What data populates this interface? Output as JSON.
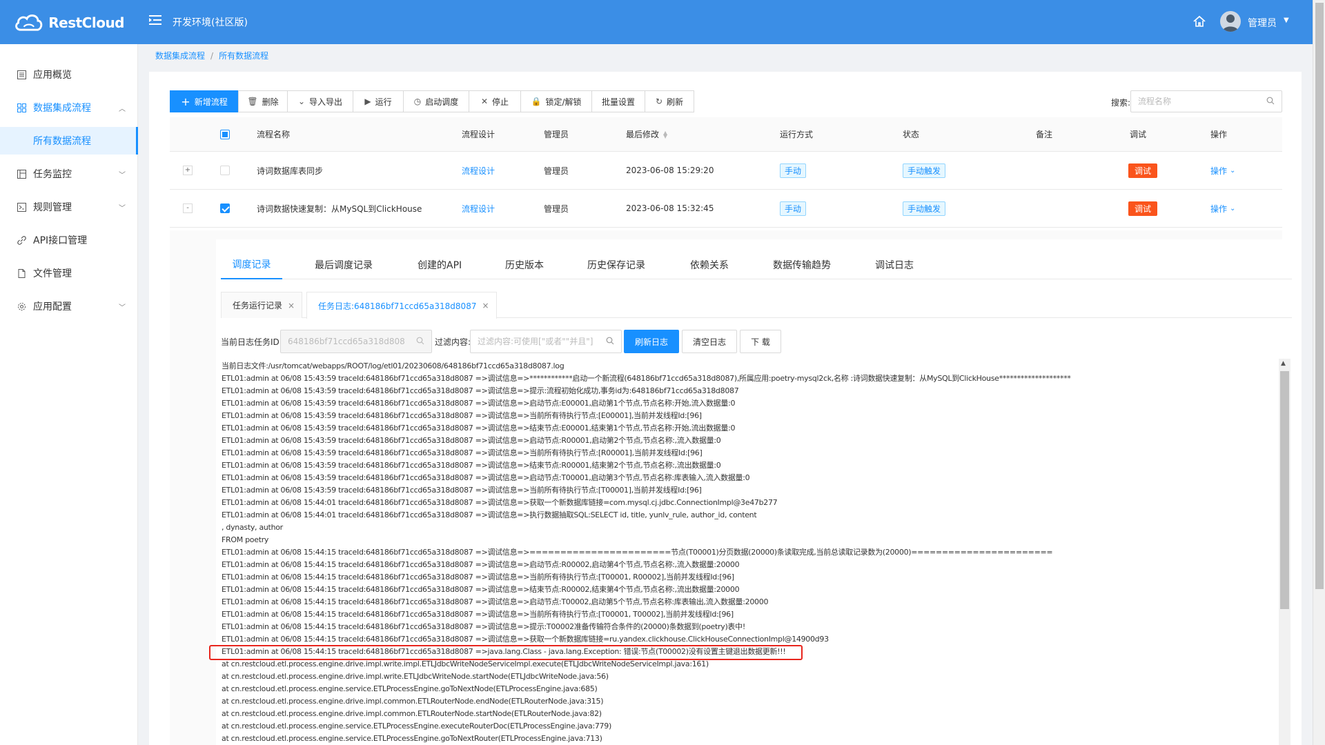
{
  "app": {
    "logo_text": "RestCloud",
    "env_title": "开发环境(社区版)",
    "user_name": "管理员"
  },
  "sidebar": {
    "items": [
      {
        "label": "应用概览",
        "icon": "dashboard-icon"
      },
      {
        "label": "数据集成流程",
        "icon": "grid-icon",
        "open": true
      },
      {
        "label": "所有数据流程",
        "sub": true
      },
      {
        "label": "任务监控",
        "icon": "monitor-icon"
      },
      {
        "label": "规则管理",
        "icon": "code-icon"
      },
      {
        "label": "API接口管理",
        "icon": "link-icon"
      },
      {
        "label": "文件管理",
        "icon": "file-icon"
      },
      {
        "label": "应用配置",
        "icon": "gear-icon"
      }
    ]
  },
  "breadcrumb": [
    "数据集成流程",
    "所有数据流程"
  ],
  "toolbar": {
    "new": "新增流程",
    "delete": "删除",
    "import_export": "导入导出",
    "run": "运行",
    "schedule": "启动调度",
    "stop": "停止",
    "lock": "锁定/解锁",
    "batch": "批量设置",
    "refresh": "刷新"
  },
  "search": {
    "label": "搜索:",
    "placeholder": "流程名称"
  },
  "table": {
    "headers": {
      "name": "流程名称",
      "design": "流程设计",
      "owner": "管理员",
      "modified": "最后修改",
      "run_mode": "运行方式",
      "status": "状态",
      "note": "备注",
      "debug": "调试",
      "action": "操作"
    },
    "rows": [
      {
        "expand": "+",
        "name": "诗词数据库表同步",
        "design": "流程设计",
        "owner": "管理员",
        "modified": "2023-06-08 15:29:20",
        "run_mode": "手动",
        "status": "手动触发",
        "debug": "调试",
        "action": "操作"
      },
      {
        "expand": "-",
        "name": "诗词数据快速复制：从MySQL到ClickHouse",
        "design": "流程设计",
        "owner": "管理员",
        "modified": "2023-06-08 15:32:45",
        "run_mode": "手动",
        "status": "手动触发",
        "debug": "调试",
        "action": "操作"
      }
    ]
  },
  "detail_tabs": [
    "调度记录",
    "最后调度记录",
    "创建的API",
    "历史版本",
    "历史保存记录",
    "依赖关系",
    "数据传输趋势",
    "调试日志"
  ],
  "content_tabs": [
    "任务运行记录",
    "任务日志:648186bf71ccd65a318d8087"
  ],
  "logbar": {
    "task_id_label": "当前日志任务ID:",
    "task_id_value": "648186bf71ccd65a318d8087",
    "filter_label": "过滤内容:",
    "filter_placeholder": "过滤内容:可使用[\"或者\"\"并且\"]",
    "refresh_btn": "刷新日志",
    "clear_btn": "清空日志",
    "download_btn": "下 载"
  },
  "log_lines": [
    "当前日志文件:/usr/tomcat/webapps/ROOT/log/etl01/20230608/648186bf71ccd65a318d8087.log",
    "ETL01:admin at 06/08 15:43:59 traceId:648186bf71ccd65a318d8087 =>调试信息=>************启动一个新流程(648186bf71ccd65a318d8087),所属应用:poetry-mysql2ck,名称 :诗词数据快速复制：从MySQL到ClickHouse********************",
    "ETL01:admin at 06/08 15:43:59 traceId:648186bf71ccd65a318d8087 =>调试信息=>提示:流程初始化成功,事务id为:648186bf71ccd65a318d8087",
    "ETL01:admin at 06/08 15:43:59 traceId:648186bf71ccd65a318d8087 =>调试信息=>启动节点:E00001,启动第1个节点,节点名称:开始,流入数据量:0",
    "ETL01:admin at 06/08 15:43:59 traceId:648186bf71ccd65a318d8087 =>调试信息=>当前所有待执行节点:[E00001],当前并发线程Id:[96]",
    "ETL01:admin at 06/08 15:43:59 traceId:648186bf71ccd65a318d8087 =>调试信息=>结束节点:E00001,结束第1个节点,节点名称:开始,流出数据量:0",
    "ETL01:admin at 06/08 15:43:59 traceId:648186bf71ccd65a318d8087 =>调试信息=>启动节点:R00001,启动第2个节点,节点名称:,流入数据量:0",
    "ETL01:admin at 06/08 15:43:59 traceId:648186bf71ccd65a318d8087 =>调试信息=>当前所有待执行节点:[R00001],当前并发线程Id:[96]",
    "ETL01:admin at 06/08 15:43:59 traceId:648186bf71ccd65a318d8087 =>调试信息=>结束节点:R00001,结束第2个节点,节点名称:,流出数据量:0",
    "ETL01:admin at 06/08 15:43:59 traceId:648186bf71ccd65a318d8087 =>调试信息=>启动节点:T00001,启动第3个节点,节点名称:库表输入,流入数据量:0",
    "ETL01:admin at 06/08 15:43:59 traceId:648186bf71ccd65a318d8087 =>调试信息=>当前所有待执行节点:[T00001],当前并发线程Id:[96]",
    "ETL01:admin at 06/08 15:44:01 traceId:648186bf71ccd65a318d8087 =>调试信息=>获取一个新数据库链接=com.mysql.cj.jdbc.ConnectionImpl@3e47b277",
    "ETL01:admin at 06/08 15:44:01 traceId:648186bf71ccd65a318d8087 =>调试信息=>执行数据抽取SQL:SELECT id, title, yunlv_rule, author_id, content",
    ", dynasty, author",
    "FROM poetry",
    "ETL01:admin at 06/08 15:44:15 traceId:648186bf71ccd65a318d8087 =>调试信息=>=======================节点(T00001)分页数据(20000)条读取完成,当前总读取记录数为(20000)=======================",
    "ETL01:admin at 06/08 15:44:15 traceId:648186bf71ccd65a318d8087 =>调试信息=>启动节点:R00002,启动第4个节点,节点名称:,流入数据量:20000",
    "ETL01:admin at 06/08 15:44:15 traceId:648186bf71ccd65a318d8087 =>调试信息=>当前所有待执行节点:[T00001, R00002],当前并发线程Id:[96]",
    "ETL01:admin at 06/08 15:44:15 traceId:648186bf71ccd65a318d8087 =>调试信息=>结束节点:R00002,结束第4个节点,节点名称:,流出数据量:20000",
    "ETL01:admin at 06/08 15:44:15 traceId:648186bf71ccd65a318d8087 =>调试信息=>启动节点:T00002,启动第5个节点,节点名称:库表输出,流入数据量:20000",
    "ETL01:admin at 06/08 15:44:15 traceId:648186bf71ccd65a318d8087 =>调试信息=>当前所有待执行节点:[T00001, T00002],当前并发线程Id:[96]",
    "ETL01:admin at 06/08 15:44:15 traceId:648186bf71ccd65a318d8087 =>调试信息=>提示:T00002准备传输符合条件的(20000)条数据到(poetry)表中!",
    "ETL01:admin at 06/08 15:44:15 traceId:648186bf71ccd65a318d8087 =>调试信息=>获取一个新数据库链接=ru.yandex.clickhouse.ClickHouseConnectionImpl@14900d93",
    "ETL01:admin at 06/08 15:44:15 traceId:648186bf71ccd65a318d8087 =>java.lang.Class - java.lang.Exception: 错误:节点(T00002)没有设置主键退出数据更新!!!",
    "at cn.restcloud.etl.process.engine.drive.impl.write.impl.ETLJdbcWriteNodeServiceImpl.execute(ETLJdbcWriteNodeServiceImpl.java:161)",
    "at cn.restcloud.etl.process.engine.drive.impl.write.ETLJdbcWriteNode.startNode(ETLJdbcWriteNode.java:56)",
    "at cn.restcloud.etl.process.engine.service.ETLProcessEngine.goToNextNode(ETLProcessEngine.java:685)",
    "at cn.restcloud.etl.process.engine.drive.impl.common.ETLRouterNode.endNode(ETLRouterNode.java:315)",
    "at cn.restcloud.etl.process.engine.drive.impl.common.ETLRouterNode.startNode(ETLRouterNode.java:82)",
    "at cn.restcloud.etl.process.engine.service.ETLProcessEngine.executeRouterDoc(ETLProcessEngine.java:779)",
    "at cn.restcloud.etl.process.engine.service.ETLProcessEngine.goToNextRouter(ETLProcessEngine.java:713)"
  ]
}
